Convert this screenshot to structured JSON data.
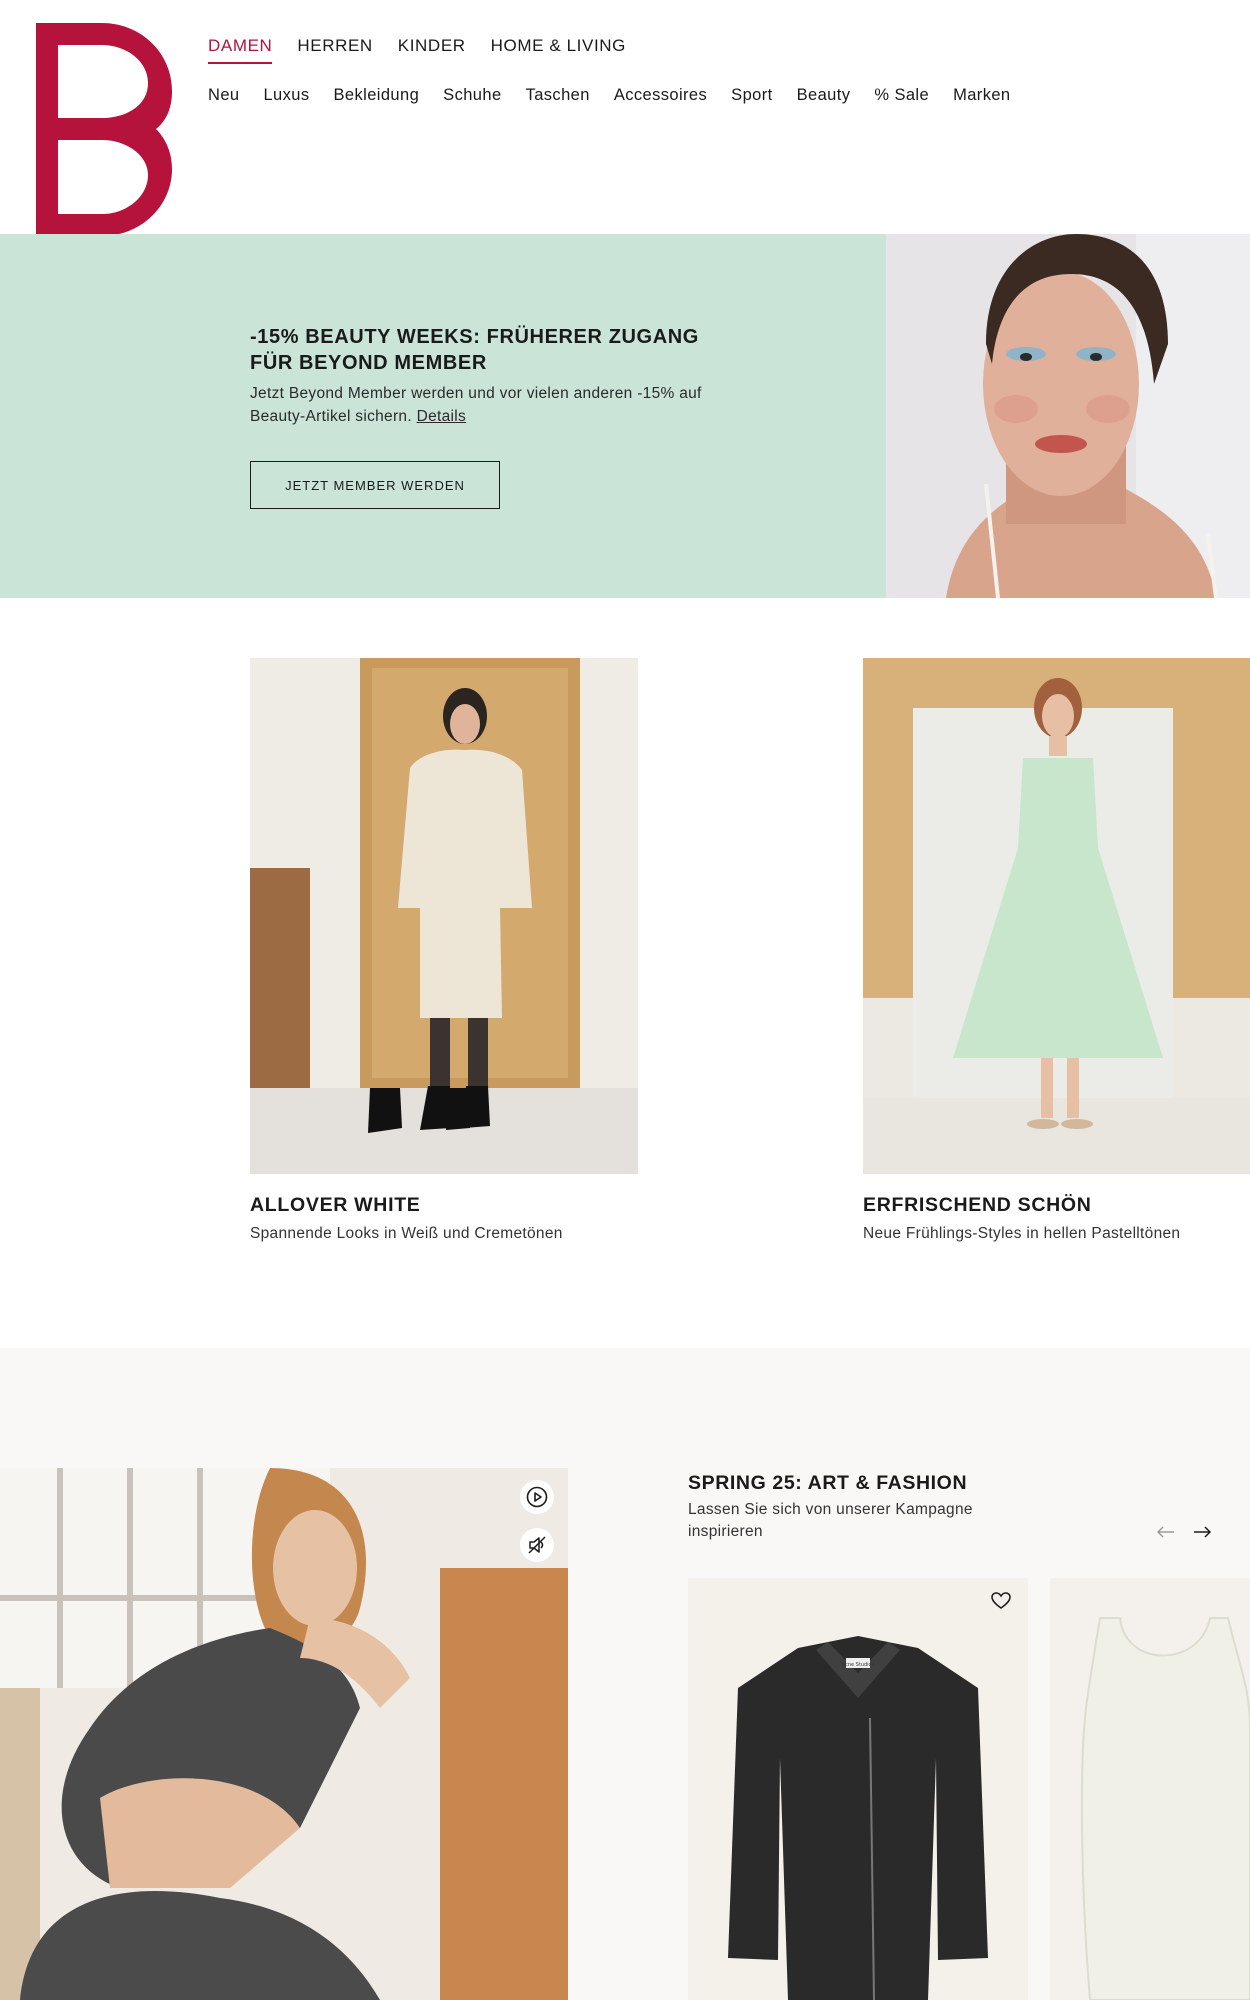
{
  "brand": {
    "name": "Breuninger",
    "accent": "#b5123c"
  },
  "top_nav": [
    {
      "label": "DAMEN",
      "active": true
    },
    {
      "label": "HERREN",
      "active": false
    },
    {
      "label": "KINDER",
      "active": false
    },
    {
      "label": "HOME & LIVING",
      "active": false
    }
  ],
  "sub_nav": [
    "Neu",
    "Luxus",
    "Bekleidung",
    "Schuhe",
    "Taschen",
    "Accessoires",
    "Sport",
    "Beauty",
    "% Sale",
    "Marken"
  ],
  "promo": {
    "title": "-15% BEAUTY WEEKS: FRÜHERER ZUGANG FÜR BEYOND MEMBER",
    "body": "Jetzt Beyond Member werden und vor vielen anderen -15% auf Beauty-Artikel sichern.",
    "link": "Details",
    "button": "JETZT MEMBER WERDEN",
    "background": "#cae5d8"
  },
  "tiles": [
    {
      "title": "ALLOVER WHITE",
      "subtitle": "Spannende Looks in Weiß und Cremetönen"
    },
    {
      "title": "ERFRISCHEND SCHÖN",
      "subtitle": "Neue Frühlings-Styles in hellen Pastelltönen"
    }
  ],
  "campaign": {
    "title": "SPRING 25: ART & FASHION",
    "subtitle": "Lassen Sie sich von unserer Kampagne inspirieren",
    "jacket_label": "Acne Studios"
  }
}
